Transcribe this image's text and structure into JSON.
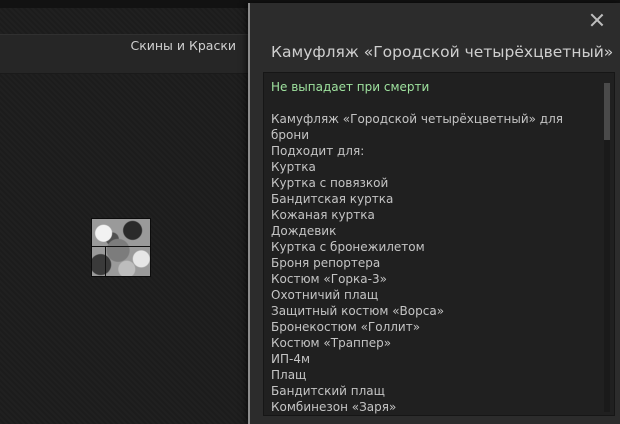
{
  "left_panel": {
    "header_title": "Скины и Краски"
  },
  "modal": {
    "title": "Камуфляж «Городской четырёхцветный»",
    "no_drop_text": "Не выпадает при смерти",
    "description_lines": [
      "Камуфляж «Городской четырёхцветный» для",
      "брони",
      "Подходит для:",
      "Куртка",
      "Куртка с повязкой",
      "Бандитская куртка",
      "Кожаная куртка",
      "Дождевик",
      "Куртка с бронежилетом",
      "Броня репортера",
      "Костюм «Горка-3»",
      "Охотничий плащ",
      "Защитный костюм «Ворса»",
      "Бронекостюм «Голлит»",
      "Костюм «Траппер»",
      "ИП-4м",
      "Плащ",
      "Бандитский плащ",
      "Комбинезон «Заря»"
    ],
    "scroll_position_fraction": 0.0
  }
}
